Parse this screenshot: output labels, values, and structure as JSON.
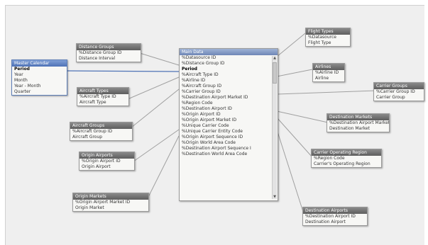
{
  "tables": {
    "master_calendar": {
      "title": "Master Calendar",
      "fields": [
        "Period",
        "Year",
        "Month",
        "Year - Month",
        "Quarter"
      ]
    },
    "distance_groups": {
      "title": "Distance Groups",
      "fields": [
        "%Distance Group ID",
        "Distance Interval"
      ]
    },
    "aircraft_types": {
      "title": "Aircraft Types",
      "fields": [
        "%Aircraft Type ID",
        "Aircraft Type"
      ]
    },
    "aircraft_groups": {
      "title": "Aircraft Groups",
      "fields": [
        "%Aircraft Group ID",
        "Aircraft Group"
      ]
    },
    "origin_airports": {
      "title": "Origin Airports",
      "fields": [
        "%Origin Airport ID",
        "Origin Airport"
      ]
    },
    "origin_markets": {
      "title": "Origin Markets",
      "fields": [
        "%Origin Airport Market ID",
        "Origin Market"
      ]
    },
    "main_data": {
      "title": "Main Data",
      "fields": [
        "%Datasource ID",
        "%Distance Group ID",
        "Period",
        "%Aircraft Type ID",
        "%Airline ID",
        "%Aircraft Group ID",
        "%Carrier Group ID",
        "%Destination Airport Market ID",
        "%Region Code",
        "%Destination Airport ID",
        "%Origin Airport ID",
        "%Origin Airport Market ID",
        "%Unique Carrier Code",
        "%Unique Carrier Entity Code",
        "%Origin Airport Sequence ID",
        "%Origin World Area Code",
        "%Destination Airport Sequence I",
        "%Destination World Area Code"
      ]
    },
    "flight_types": {
      "title": "Flight Types",
      "fields": [
        "%Datasource",
        "Flight Type"
      ]
    },
    "airlines": {
      "title": "Airlines",
      "fields": [
        "%Airline ID",
        "Airline"
      ]
    },
    "carrier_groups": {
      "title": "Carrier Groups",
      "fields": [
        "%Carrier Group ID",
        "Carrier Group"
      ]
    },
    "destination_markets": {
      "title": "Destination Markets",
      "fields": [
        "%Destination Airport Market I",
        "Destination Market"
      ]
    },
    "carrier_operating_region": {
      "title": "Carrier Operating Region",
      "fields": [
        "%Region Code",
        "Carrier's Operating Region"
      ]
    },
    "destination_airports": {
      "title": "Destination Airports",
      "fields": [
        "%Destination Airport ID",
        "Destination Airport"
      ]
    }
  },
  "colors": {
    "accent": "#4f73b6",
    "header": "#6e6e6e",
    "link": "#a0a0a0",
    "active_link": "#4f73b6"
  },
  "icons": {
    "scroll_up": "triangle-up",
    "scroll_down": "triangle-down"
  }
}
